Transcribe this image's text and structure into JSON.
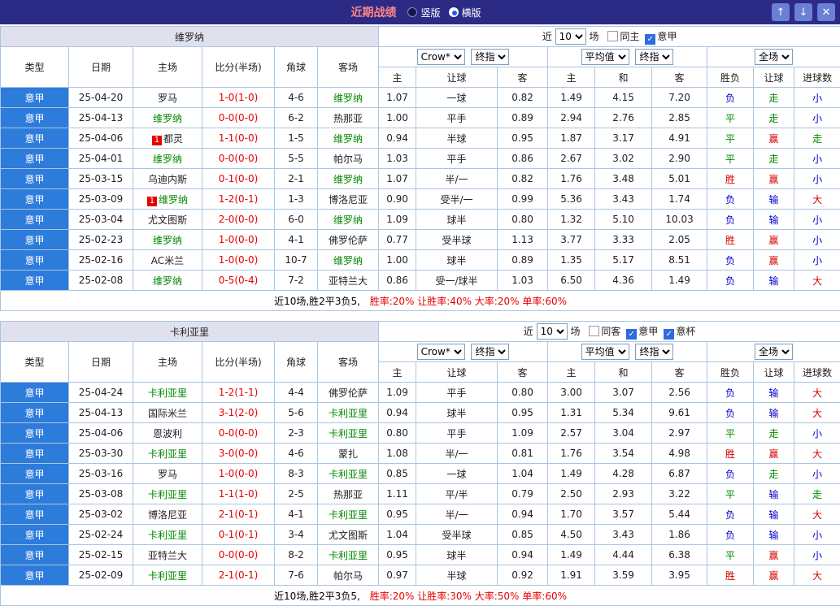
{
  "palette": {
    "team_selected": "#008800",
    "score": "#e60000",
    "league_bg": "#2d7cdb",
    "titlebar_bg": "#2b2a85",
    "button_bg": "#6a7fd6"
  },
  "result_colors": {
    "胜": "#d60000",
    "平": "#008a00",
    "负": "#0000cc",
    "赢": "#d60000",
    "走": "#008a00",
    "输": "#0000cc",
    "大": "#d60000",
    "小": "#0000cc"
  },
  "titlebar": {
    "title": "近期战绩",
    "radios": [
      {
        "label": "竖版",
        "selected": false
      },
      {
        "label": "横版",
        "selected": true
      }
    ],
    "buttons": [
      {
        "name": "scroll-up-button",
        "glyph": "↑"
      },
      {
        "name": "scroll-down-button",
        "glyph": "↓"
      },
      {
        "name": "close-button",
        "glyph": "✕"
      }
    ]
  },
  "columns": {
    "type": "类型",
    "date": "日期",
    "home": "主场",
    "score": "比分(半场)",
    "corner": "角球",
    "away": "客场",
    "sub": [
      "主",
      "让球",
      "客",
      "主",
      "和",
      "客",
      "胜负",
      "让球",
      "进球数"
    ]
  },
  "tables": [
    {
      "team": "维罗纳",
      "filter": {
        "near": "近",
        "count": "10",
        "unit": "场",
        "checkboxes": [
          {
            "label": "同主",
            "checked": false
          },
          {
            "label": "意甲",
            "checked": true
          }
        ]
      },
      "selects": {
        "book": "Crow*",
        "book_final": "终指",
        "avg": "平均值",
        "avg_final": "终指",
        "scope": "全场"
      },
      "rows": [
        {
          "league": "意甲",
          "date": "25-04-20",
          "home": "罗马",
          "home_selected": false,
          "badge": "",
          "score": "1-0(1-0)",
          "corner": "4-6",
          "away": "维罗纳",
          "away_selected": true,
          "asian": [
            "1.07",
            "一球",
            "0.82"
          ],
          "euro": [
            "1.49",
            "4.15",
            "7.20"
          ],
          "results": [
            "负",
            "走",
            "小"
          ]
        },
        {
          "league": "意甲",
          "date": "25-04-13",
          "home": "维罗纳",
          "home_selected": true,
          "badge": "",
          "score": "0-0(0-0)",
          "corner": "6-2",
          "away": "热那亚",
          "away_selected": false,
          "asian": [
            "1.00",
            "平手",
            "0.89"
          ],
          "euro": [
            "2.94",
            "2.76",
            "2.85"
          ],
          "results": [
            "平",
            "走",
            "小"
          ]
        },
        {
          "league": "意甲",
          "date": "25-04-06",
          "home": "都灵",
          "home_selected": false,
          "badge": "1",
          "score": "1-1(0-0)",
          "corner": "1-5",
          "away": "维罗纳",
          "away_selected": true,
          "asian": [
            "0.94",
            "半球",
            "0.95"
          ],
          "euro": [
            "1.87",
            "3.17",
            "4.91"
          ],
          "results": [
            "平",
            "赢",
            "走"
          ]
        },
        {
          "league": "意甲",
          "date": "25-04-01",
          "home": "维罗纳",
          "home_selected": true,
          "badge": "",
          "score": "0-0(0-0)",
          "corner": "5-5",
          "away": "帕尔马",
          "away_selected": false,
          "asian": [
            "1.03",
            "平手",
            "0.86"
          ],
          "euro": [
            "2.67",
            "3.02",
            "2.90"
          ],
          "results": [
            "平",
            "走",
            "小"
          ]
        },
        {
          "league": "意甲",
          "date": "25-03-15",
          "home": "乌迪内斯",
          "home_selected": false,
          "badge": "",
          "score": "0-1(0-0)",
          "corner": "2-1",
          "away": "维罗纳",
          "away_selected": true,
          "asian": [
            "1.07",
            "半/一",
            "0.82"
          ],
          "euro": [
            "1.76",
            "3.48",
            "5.01"
          ],
          "results": [
            "胜",
            "赢",
            "小"
          ]
        },
        {
          "league": "意甲",
          "date": "25-03-09",
          "home": "维罗纳",
          "home_selected": true,
          "badge": "1",
          "score": "1-2(0-1)",
          "corner": "1-3",
          "away": "博洛尼亚",
          "away_selected": false,
          "asian": [
            "0.90",
            "受半/一",
            "0.99"
          ],
          "euro": [
            "5.36",
            "3.43",
            "1.74"
          ],
          "results": [
            "负",
            "输",
            "大"
          ]
        },
        {
          "league": "意甲",
          "date": "25-03-04",
          "home": "尤文图斯",
          "home_selected": false,
          "badge": "",
          "score": "2-0(0-0)",
          "corner": "6-0",
          "away": "维罗纳",
          "away_selected": true,
          "asian": [
            "1.09",
            "球半",
            "0.80"
          ],
          "euro": [
            "1.32",
            "5.10",
            "10.03"
          ],
          "results": [
            "负",
            "输",
            "小"
          ]
        },
        {
          "league": "意甲",
          "date": "25-02-23",
          "home": "维罗纳",
          "home_selected": true,
          "badge": "",
          "score": "1-0(0-0)",
          "corner": "4-1",
          "away": "佛罗伦萨",
          "away_selected": false,
          "asian": [
            "0.77",
            "受半球",
            "1.13"
          ],
          "euro": [
            "3.77",
            "3.33",
            "2.05"
          ],
          "results": [
            "胜",
            "赢",
            "小"
          ]
        },
        {
          "league": "意甲",
          "date": "25-02-16",
          "home": "AC米兰",
          "home_selected": false,
          "badge": "",
          "score": "1-0(0-0)",
          "corner": "10-7",
          "away": "维罗纳",
          "away_selected": true,
          "asian": [
            "1.00",
            "球半",
            "0.89"
          ],
          "euro": [
            "1.35",
            "5.17",
            "8.51"
          ],
          "results": [
            "负",
            "赢",
            "小"
          ]
        },
        {
          "league": "意甲",
          "date": "25-02-08",
          "home": "维罗纳",
          "home_selected": true,
          "badge": "",
          "score": "0-5(0-4)",
          "corner": "7-2",
          "away": "亚特兰大",
          "away_selected": false,
          "asian": [
            "0.86",
            "受一/球半",
            "1.03"
          ],
          "euro": [
            "6.50",
            "4.36",
            "1.49"
          ],
          "results": [
            "负",
            "输",
            "大"
          ]
        }
      ],
      "summary": {
        "prefix": "近10场,胜2平3负5,",
        "rates": "胜率:20% 让胜率:40% 大率:20% 单率:60%"
      }
    },
    {
      "team": "卡利亚里",
      "filter": {
        "near": "近",
        "count": "10",
        "unit": "场",
        "checkboxes": [
          {
            "label": "同客",
            "checked": false
          },
          {
            "label": "意甲",
            "checked": true
          },
          {
            "label": "意杯",
            "checked": true
          }
        ]
      },
      "selects": {
        "book": "Crow*",
        "book_final": "终指",
        "avg": "平均值",
        "avg_final": "终指",
        "scope": "全场"
      },
      "rows": [
        {
          "league": "意甲",
          "date": "25-04-24",
          "home": "卡利亚里",
          "home_selected": true,
          "badge": "",
          "score": "1-2(1-1)",
          "corner": "4-4",
          "away": "佛罗伦萨",
          "away_selected": false,
          "asian": [
            "1.09",
            "平手",
            "0.80"
          ],
          "euro": [
            "3.00",
            "3.07",
            "2.56"
          ],
          "results": [
            "负",
            "输",
            "大"
          ]
        },
        {
          "league": "意甲",
          "date": "25-04-13",
          "home": "国际米兰",
          "home_selected": false,
          "badge": "",
          "score": "3-1(2-0)",
          "corner": "5-6",
          "away": "卡利亚里",
          "away_selected": true,
          "asian": [
            "0.94",
            "球半",
            "0.95"
          ],
          "euro": [
            "1.31",
            "5.34",
            "9.61"
          ],
          "results": [
            "负",
            "输",
            "大"
          ]
        },
        {
          "league": "意甲",
          "date": "25-04-06",
          "home": "恩波利",
          "home_selected": false,
          "badge": "",
          "score": "0-0(0-0)",
          "corner": "2-3",
          "away": "卡利亚里",
          "away_selected": true,
          "asian": [
            "0.80",
            "平手",
            "1.09"
          ],
          "euro": [
            "2.57",
            "3.04",
            "2.97"
          ],
          "results": [
            "平",
            "走",
            "小"
          ]
        },
        {
          "league": "意甲",
          "date": "25-03-30",
          "home": "卡利亚里",
          "home_selected": true,
          "badge": "",
          "score": "3-0(0-0)",
          "corner": "4-6",
          "away": "蒙扎",
          "away_selected": false,
          "asian": [
            "1.08",
            "半/一",
            "0.81"
          ],
          "euro": [
            "1.76",
            "3.54",
            "4.98"
          ],
          "results": [
            "胜",
            "赢",
            "大"
          ]
        },
        {
          "league": "意甲",
          "date": "25-03-16",
          "home": "罗马",
          "home_selected": false,
          "badge": "",
          "score": "1-0(0-0)",
          "corner": "8-3",
          "away": "卡利亚里",
          "away_selected": true,
          "asian": [
            "0.85",
            "一球",
            "1.04"
          ],
          "euro": [
            "1.49",
            "4.28",
            "6.87"
          ],
          "results": [
            "负",
            "走",
            "小"
          ]
        },
        {
          "league": "意甲",
          "date": "25-03-08",
          "home": "卡利亚里",
          "home_selected": true,
          "badge": "",
          "score": "1-1(1-0)",
          "corner": "2-5",
          "away": "热那亚",
          "away_selected": false,
          "asian": [
            "1.11",
            "平/半",
            "0.79"
          ],
          "euro": [
            "2.50",
            "2.93",
            "3.22"
          ],
          "results": [
            "平",
            "输",
            "走"
          ]
        },
        {
          "league": "意甲",
          "date": "25-03-02",
          "home": "博洛尼亚",
          "home_selected": false,
          "badge": "",
          "score": "2-1(0-1)",
          "corner": "4-1",
          "away": "卡利亚里",
          "away_selected": true,
          "asian": [
            "0.95",
            "半/一",
            "0.94"
          ],
          "euro": [
            "1.70",
            "3.57",
            "5.44"
          ],
          "results": [
            "负",
            "输",
            "大"
          ]
        },
        {
          "league": "意甲",
          "date": "25-02-24",
          "home": "卡利亚里",
          "home_selected": true,
          "badge": "",
          "score": "0-1(0-1)",
          "corner": "3-4",
          "away": "尤文图斯",
          "away_selected": false,
          "asian": [
            "1.04",
            "受半球",
            "0.85"
          ],
          "euro": [
            "4.50",
            "3.43",
            "1.86"
          ],
          "results": [
            "负",
            "输",
            "小"
          ]
        },
        {
          "league": "意甲",
          "date": "25-02-15",
          "home": "亚特兰大",
          "home_selected": false,
          "badge": "",
          "score": "0-0(0-0)",
          "corner": "8-2",
          "away": "卡利亚里",
          "away_selected": true,
          "asian": [
            "0.95",
            "球半",
            "0.94"
          ],
          "euro": [
            "1.49",
            "4.44",
            "6.38"
          ],
          "results": [
            "平",
            "赢",
            "小"
          ]
        },
        {
          "league": "意甲",
          "date": "25-02-09",
          "home": "卡利亚里",
          "home_selected": true,
          "badge": "",
          "score": "2-1(0-1)",
          "corner": "7-6",
          "away": "帕尔马",
          "away_selected": false,
          "asian": [
            "0.97",
            "半球",
            "0.92"
          ],
          "euro": [
            "1.91",
            "3.59",
            "3.95"
          ],
          "results": [
            "胜",
            "赢",
            "大"
          ]
        }
      ],
      "summary": {
        "prefix": "近10场,胜2平3负5,",
        "rates": "胜率:20% 让胜率:30% 大率:50% 单率:60%"
      }
    }
  ]
}
